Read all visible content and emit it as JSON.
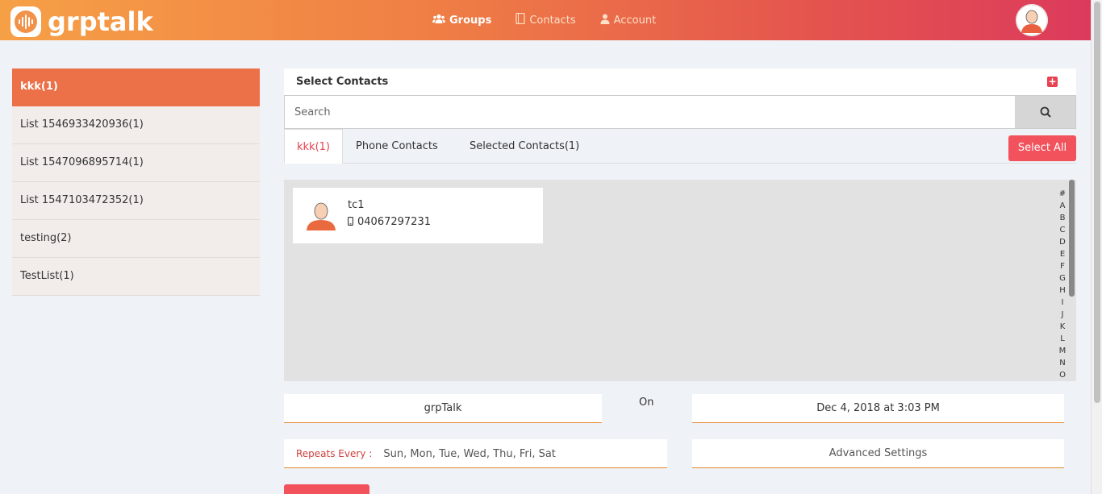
{
  "app": {
    "name": "grptalk"
  },
  "nav": {
    "items": [
      {
        "label": "Groups",
        "icon": "groups-icon"
      },
      {
        "label": "Contacts",
        "icon": "contacts-icon"
      },
      {
        "label": "Account",
        "icon": "account-icon"
      }
    ]
  },
  "sidebar": {
    "items": [
      {
        "label": "kkk(1)"
      },
      {
        "label": "List 1546933420936(1)"
      },
      {
        "label": "List 1547096895714(1)"
      },
      {
        "label": "List 1547103472352(1)"
      },
      {
        "label": "testing(2)"
      },
      {
        "label": "TestList(1)"
      }
    ]
  },
  "panel": {
    "title": "Select Contacts",
    "search_placeholder": "Search",
    "tabs": [
      {
        "label": "kkk(1)"
      },
      {
        "label": "Phone Contacts"
      },
      {
        "label": "Selected Contacts(1)"
      }
    ],
    "select_all_label": "Select All"
  },
  "contacts": [
    {
      "name": "tc1",
      "phone": "04067297231"
    }
  ],
  "alphabet": [
    "#",
    "A",
    "B",
    "C",
    "D",
    "E",
    "F",
    "G",
    "H",
    "I",
    "J",
    "K",
    "L",
    "M",
    "N",
    "O"
  ],
  "schedule": {
    "group_name": "grpTalk",
    "on_label": "On",
    "datetime": "Dec 4, 2018 at 3:03 PM",
    "repeats_label": "Repeats Every :",
    "repeats_value": "Sun, Mon, Tue, Wed, Thu, Fri, Sat",
    "advanced_label": "Advanced Settings"
  },
  "colors": {
    "accent": "#ec7048",
    "button": "#f2525c",
    "underline": "#e58a2e"
  }
}
